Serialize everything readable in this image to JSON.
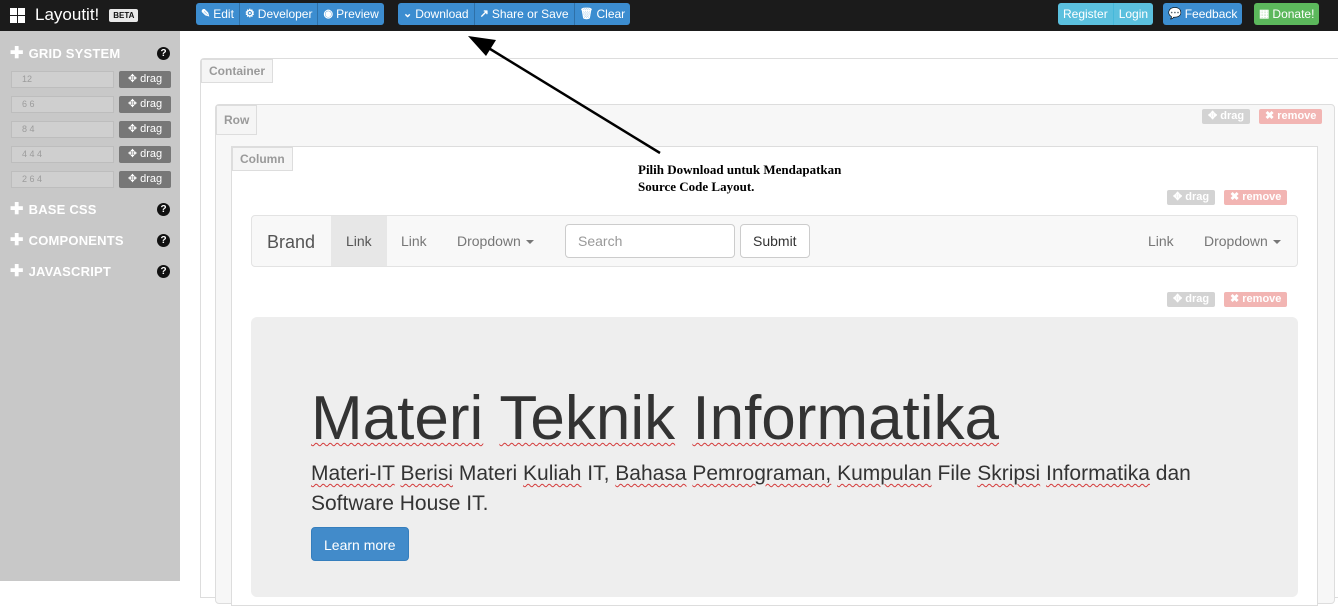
{
  "app": {
    "title": "Layoutit!",
    "badge": "BETA"
  },
  "toolbar": {
    "edit": "Edit",
    "developer": "Developer",
    "preview": "Preview",
    "download": "Download",
    "share": "Share or Save",
    "clear": "Clear",
    "register": "Register",
    "login": "Login",
    "feedback": "Feedback",
    "donate": "Donate!"
  },
  "sidebar": {
    "sections": [
      "GRID SYSTEM",
      "BASE CSS",
      "COMPONENTS",
      "JAVASCRIPT"
    ],
    "help": "?",
    "grid_rows": [
      {
        "value": "12",
        "drag": "drag"
      },
      {
        "value": "6 6",
        "drag": "drag"
      },
      {
        "value": "8 4",
        "drag": "drag"
      },
      {
        "value": "4 4 4",
        "drag": "drag"
      },
      {
        "value": "2 6 4",
        "drag": "drag"
      }
    ]
  },
  "canvas": {
    "container_label": "Container",
    "row_label": "Row",
    "column_label": "Column",
    "drag": "drag",
    "remove": "remove"
  },
  "navbar": {
    "brand": "Brand",
    "link1": "Link",
    "link2": "Link",
    "dropdown1": "Dropdown",
    "search_placeholder": "Search",
    "submit": "Submit",
    "link3": "Link",
    "dropdown2": "Dropdown"
  },
  "jumbotron": {
    "title_words": [
      "Materi",
      "Teknik",
      "Informatika"
    ],
    "text_words": [
      "Materi-IT",
      "Berisi",
      "Materi",
      "Kuliah",
      "IT,",
      "Bahasa",
      "Pemrograman,",
      "Kumpulan",
      "File",
      "Skripsi",
      "Informatika",
      "dan",
      "Software",
      "House",
      "IT."
    ],
    "button": "Learn more"
  },
  "annotation": {
    "line1": "Pilih Download untuk Mendapatkan",
    "line2": "Source Code Layout."
  }
}
